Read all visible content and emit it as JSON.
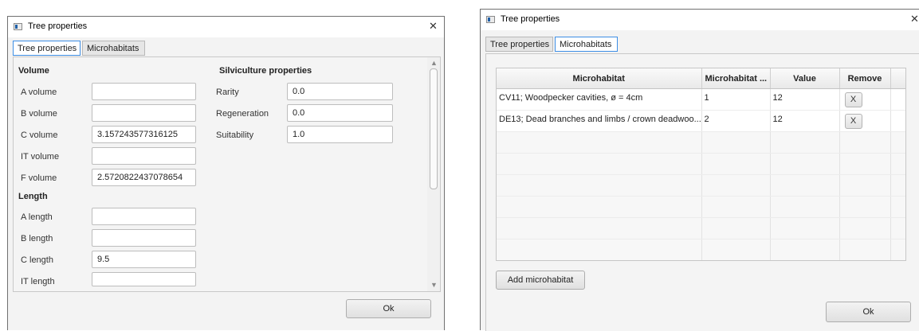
{
  "left_window": {
    "title": "Tree properties",
    "close_glyph": "✕",
    "tabs": [
      {
        "label": "Tree properties",
        "active": true
      },
      {
        "label": "Microhabitats",
        "active": false
      }
    ],
    "volume_section": {
      "heading": "Volume",
      "rows": [
        {
          "label": "A volume",
          "value": ""
        },
        {
          "label": "B volume",
          "value": ""
        },
        {
          "label": "C volume",
          "value": "3.157243577316125"
        },
        {
          "label": "IT volume",
          "value": ""
        },
        {
          "label": "F volume",
          "value": "2.5720822437078654"
        }
      ]
    },
    "length_section": {
      "heading": "Length",
      "rows": [
        {
          "label": "A length",
          "value": ""
        },
        {
          "label": "B length",
          "value": ""
        },
        {
          "label": "C length",
          "value": "9.5"
        },
        {
          "label": "IT length",
          "value": ""
        }
      ]
    },
    "silviculture_section": {
      "heading": "Silviculture properties",
      "rows": [
        {
          "label": "Rarity",
          "value": "0.0"
        },
        {
          "label": "Regeneration",
          "value": "0.0"
        },
        {
          "label": "Suitability",
          "value": "1.0"
        }
      ]
    },
    "ok_label": "Ok"
  },
  "right_window": {
    "title": "Tree properties",
    "close_glyph": "✕",
    "tabs": [
      {
        "label": "Tree properties",
        "active": false
      },
      {
        "label": "Microhabitats",
        "active": true
      }
    ],
    "table": {
      "columns": [
        "Microhabitat",
        "Microhabitat ...",
        "Value",
        "Remove"
      ],
      "rows": [
        {
          "microhabitat": "CV11; Woodpecker cavities, ø = 4cm",
          "number": "1",
          "value": "12",
          "remove": "X"
        },
        {
          "microhabitat": "DE13; Dead branches and limbs / crown deadwoo...",
          "number": "2",
          "value": "12",
          "remove": "X"
        }
      ]
    },
    "add_label": "Add microhabitat",
    "ok_label": "Ok"
  },
  "icons": {
    "app_icon": "window-app-icon",
    "close_icon": "close-icon",
    "scroll_up": "▲",
    "scroll_down": "▼"
  }
}
